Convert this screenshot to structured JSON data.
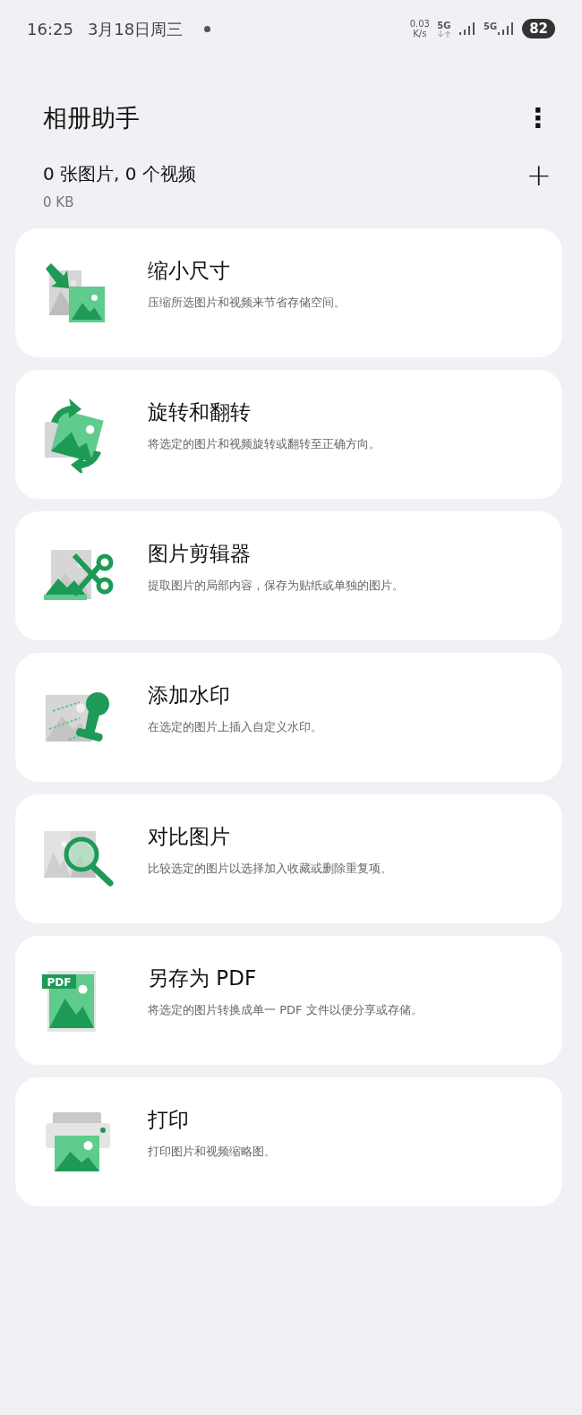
{
  "status_bar": {
    "time": "16:25",
    "date": "3月18日周三",
    "net_speed": "0.03",
    "net_unit": "K/s",
    "network_1": "5G",
    "network_2": "5G",
    "battery": "82"
  },
  "header": {
    "title": "相册助手",
    "summary": "0 张图片, 0 个视频",
    "size": "0 KB",
    "menu_icon": "⋮",
    "add_icon": "+"
  },
  "tools": [
    {
      "kind": "resize",
      "title": "缩小尺寸",
      "description": "压缩所选图片和视频来节省存储空间。"
    },
    {
      "kind": "rotate",
      "title": "旋转和翻转",
      "description": "将选定的图片和视频旋转或翻转至正确方向。"
    },
    {
      "kind": "clip",
      "title": "图片剪辑器",
      "description": "提取图片的局部内容，保存为贴纸或单独的图片。"
    },
    {
      "kind": "watermark",
      "title": "添加水印",
      "description": "在选定的图片上插入自定义水印。"
    },
    {
      "kind": "compare",
      "title": "对比图片",
      "description": "比较选定的图片以选择加入收藏或删除重复项。"
    },
    {
      "kind": "pdf",
      "title": "另存为 PDF",
      "description": "将选定的图片转换成单一 PDF 文件以便分享或存储。",
      "icon_label": "PDF"
    },
    {
      "kind": "print",
      "title": "打印",
      "description": "打印图片和视频缩略图。"
    }
  ]
}
